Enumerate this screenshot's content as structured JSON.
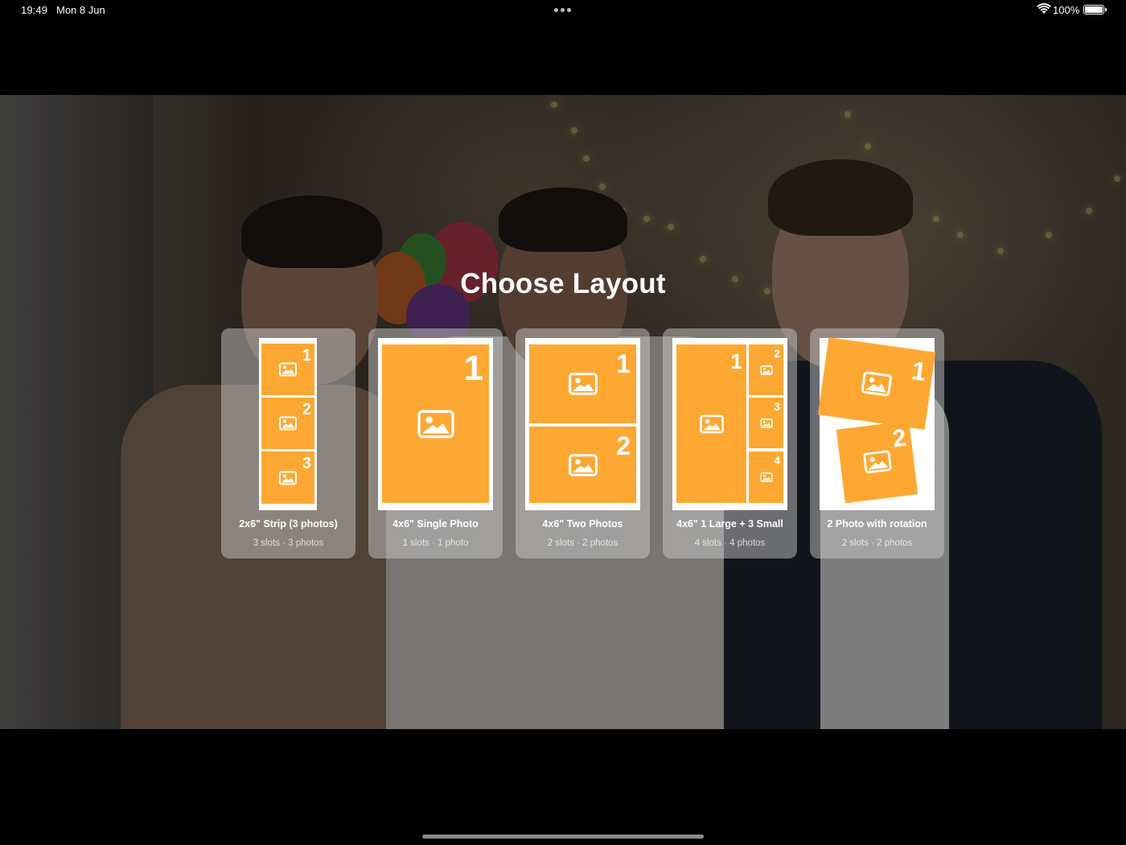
{
  "status_bar": {
    "time": "19:49",
    "date": "Mon 8 Jun",
    "battery": "100%"
  },
  "title": "Choose Layout",
  "colors": {
    "slot_orange": "#fea833",
    "card_bg": "rgba(205,205,205,0.48)"
  },
  "layouts": [
    {
      "name": "2x6\" Strip (3 photos)",
      "meta": "3 slots · 3 photos",
      "slot_numbers": [
        "1",
        "2",
        "3"
      ]
    },
    {
      "name": "4x6\" Single Photo",
      "meta": "1 slots · 1 photo",
      "slot_numbers": [
        "1"
      ]
    },
    {
      "name": "4x6\" Two Photos",
      "meta": "2 slots · 2 photos",
      "slot_numbers": [
        "1",
        "2"
      ]
    },
    {
      "name": "4x6\" 1 Large + 3 Small",
      "meta": "4 slots · 4 photos",
      "slot_numbers": [
        "1",
        "2",
        "3",
        "4"
      ]
    },
    {
      "name": "2 Photo with rotation",
      "meta": "2 slots · 2 photos",
      "slot_numbers": [
        "1",
        "2"
      ]
    }
  ],
  "icons": {
    "slot": "photo-icon",
    "wifi": "wifi-icon",
    "battery": "battery-icon"
  }
}
